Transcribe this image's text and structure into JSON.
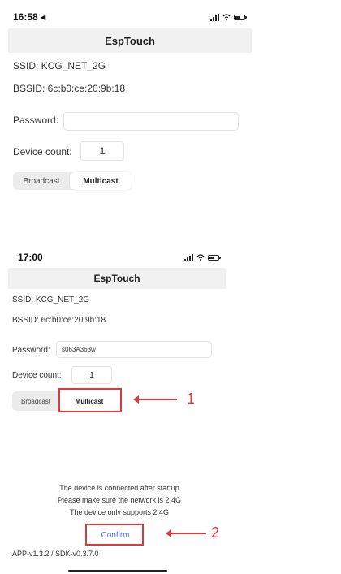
{
  "screens": [
    {
      "status_time": "16:58 ◂",
      "title": "EspTouch",
      "ssid": "SSID:  KCG_NET_2G",
      "bssid": "BSSID:  6c:b0:ce:20:9b:18",
      "password_label": "Password:",
      "password_value": "",
      "device_count_label": "Device count:",
      "device_count_value": "1",
      "broadcast_label": "Broadcast",
      "multicast_label": "Multicast"
    },
    {
      "status_time": "17:00",
      "title": "EspTouch",
      "ssid": "SSID:  KCG_NET_2G",
      "bssid": "BSSID:  6c:b0:ce:20:9b:18",
      "password_label": "Password:",
      "password_value": "s063A363w",
      "device_count_label": "Device count:",
      "device_count_value": "1",
      "broadcast_label": "Broadcast",
      "multicast_label": "Multicast",
      "message_lines": [
        "The device is connected after startup",
        "Please make sure the network is 2.4G",
        "The device only supports 2.4G"
      ],
      "confirm_label": "Confirm",
      "version": "APP-v1.3.2 / SDK-v0.3.7.0"
    }
  ],
  "annotations": {
    "callout_1": "1",
    "callout_2": "2",
    "highlight_color": "#d83b3b"
  },
  "colors": {
    "nav_background": "#f1f1f1",
    "confirm_text": "#4d72d9"
  }
}
